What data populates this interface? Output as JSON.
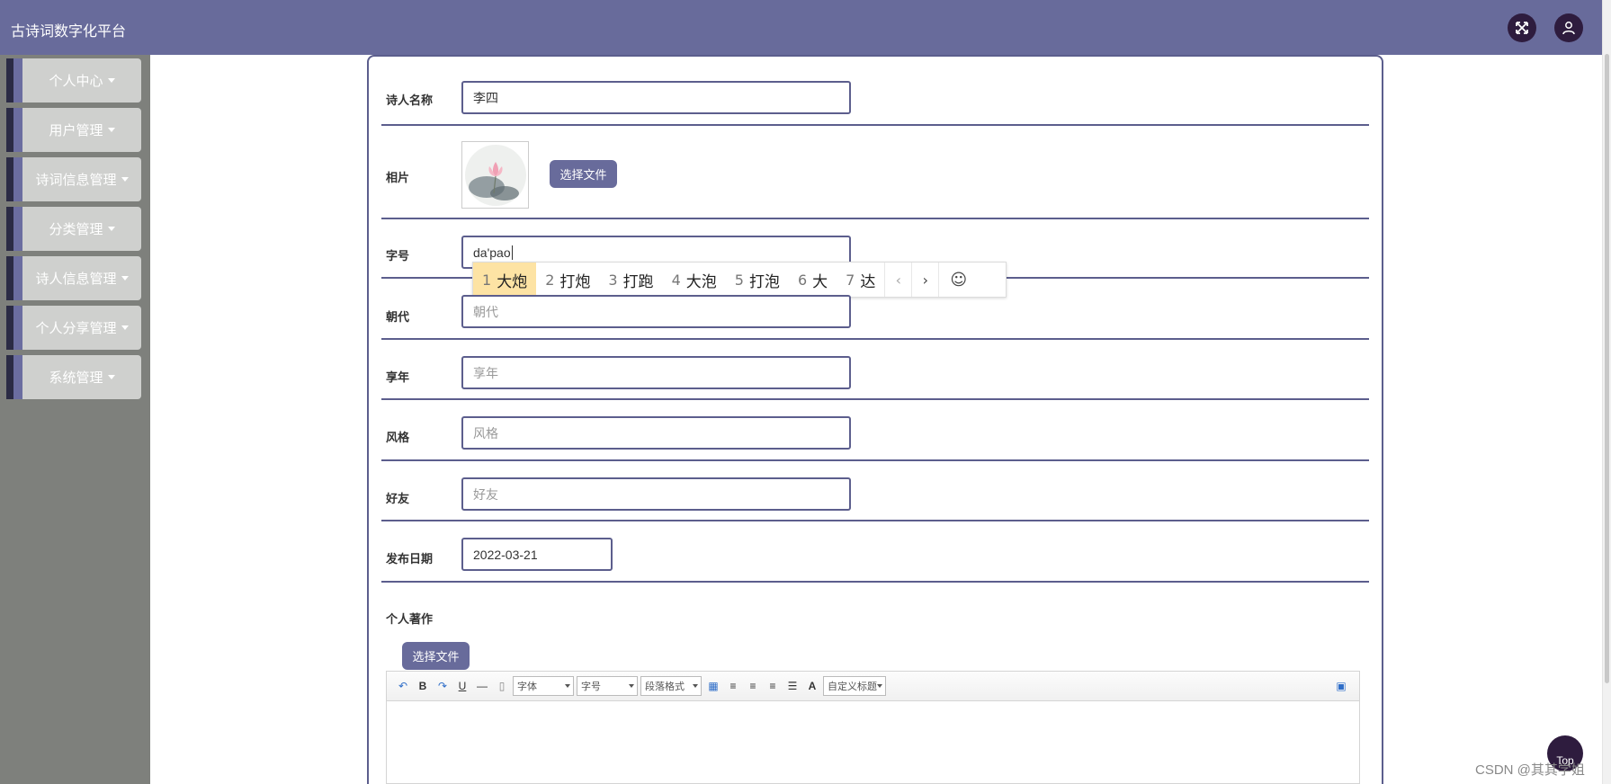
{
  "app": {
    "title": "古诗词数字化平台"
  },
  "header": {
    "fullscreen_icon": "expand-arrows-icon",
    "user_icon": "user-icon"
  },
  "sidebar": {
    "items": [
      {
        "label": "个人中心"
      },
      {
        "label": "用户管理"
      },
      {
        "label": "诗词信息管理"
      },
      {
        "label": "分类管理"
      },
      {
        "label": "诗人信息管理"
      },
      {
        "label": "个人分享管理"
      },
      {
        "label": "系统管理"
      }
    ]
  },
  "form": {
    "poet_name": {
      "label": "诗人名称",
      "value": "李四"
    },
    "photo": {
      "label": "相片",
      "button": "选择文件"
    },
    "alias": {
      "label": "字号",
      "value": "da'pao"
    },
    "dynasty": {
      "label": "朝代",
      "placeholder": "朝代"
    },
    "lifespan": {
      "label": "享年",
      "placeholder": "享年"
    },
    "style": {
      "label": "风格",
      "placeholder": "风格"
    },
    "friends": {
      "label": "好友",
      "placeholder": "好友"
    },
    "publish_date": {
      "label": "发布日期",
      "value": "2022-03-21"
    },
    "works": {
      "label": "个人著作",
      "button": "选择文件"
    }
  },
  "ime": {
    "candidates": [
      {
        "num": "1",
        "text": "大炮"
      },
      {
        "num": "2",
        "text": "打炮"
      },
      {
        "num": "3",
        "text": "打跑"
      },
      {
        "num": "4",
        "text": "大泡"
      },
      {
        "num": "5",
        "text": "打泡"
      },
      {
        "num": "6",
        "text": "大"
      },
      {
        "num": "7",
        "text": "达"
      }
    ],
    "prev": "‹",
    "next": "›",
    "emoji": "☺"
  },
  "editor": {
    "font_family": "字体",
    "font_size": "字号",
    "paragraph": "段落格式",
    "custom_title": "自定义标题"
  },
  "footer": {
    "top_button": "Top",
    "watermark": "CSDN @其其学姐"
  },
  "colors": {
    "primary": "#686b9b",
    "border": "#5c5e8d",
    "sidebar_bg": "#7e807c",
    "dark": "#2e1c3e"
  }
}
